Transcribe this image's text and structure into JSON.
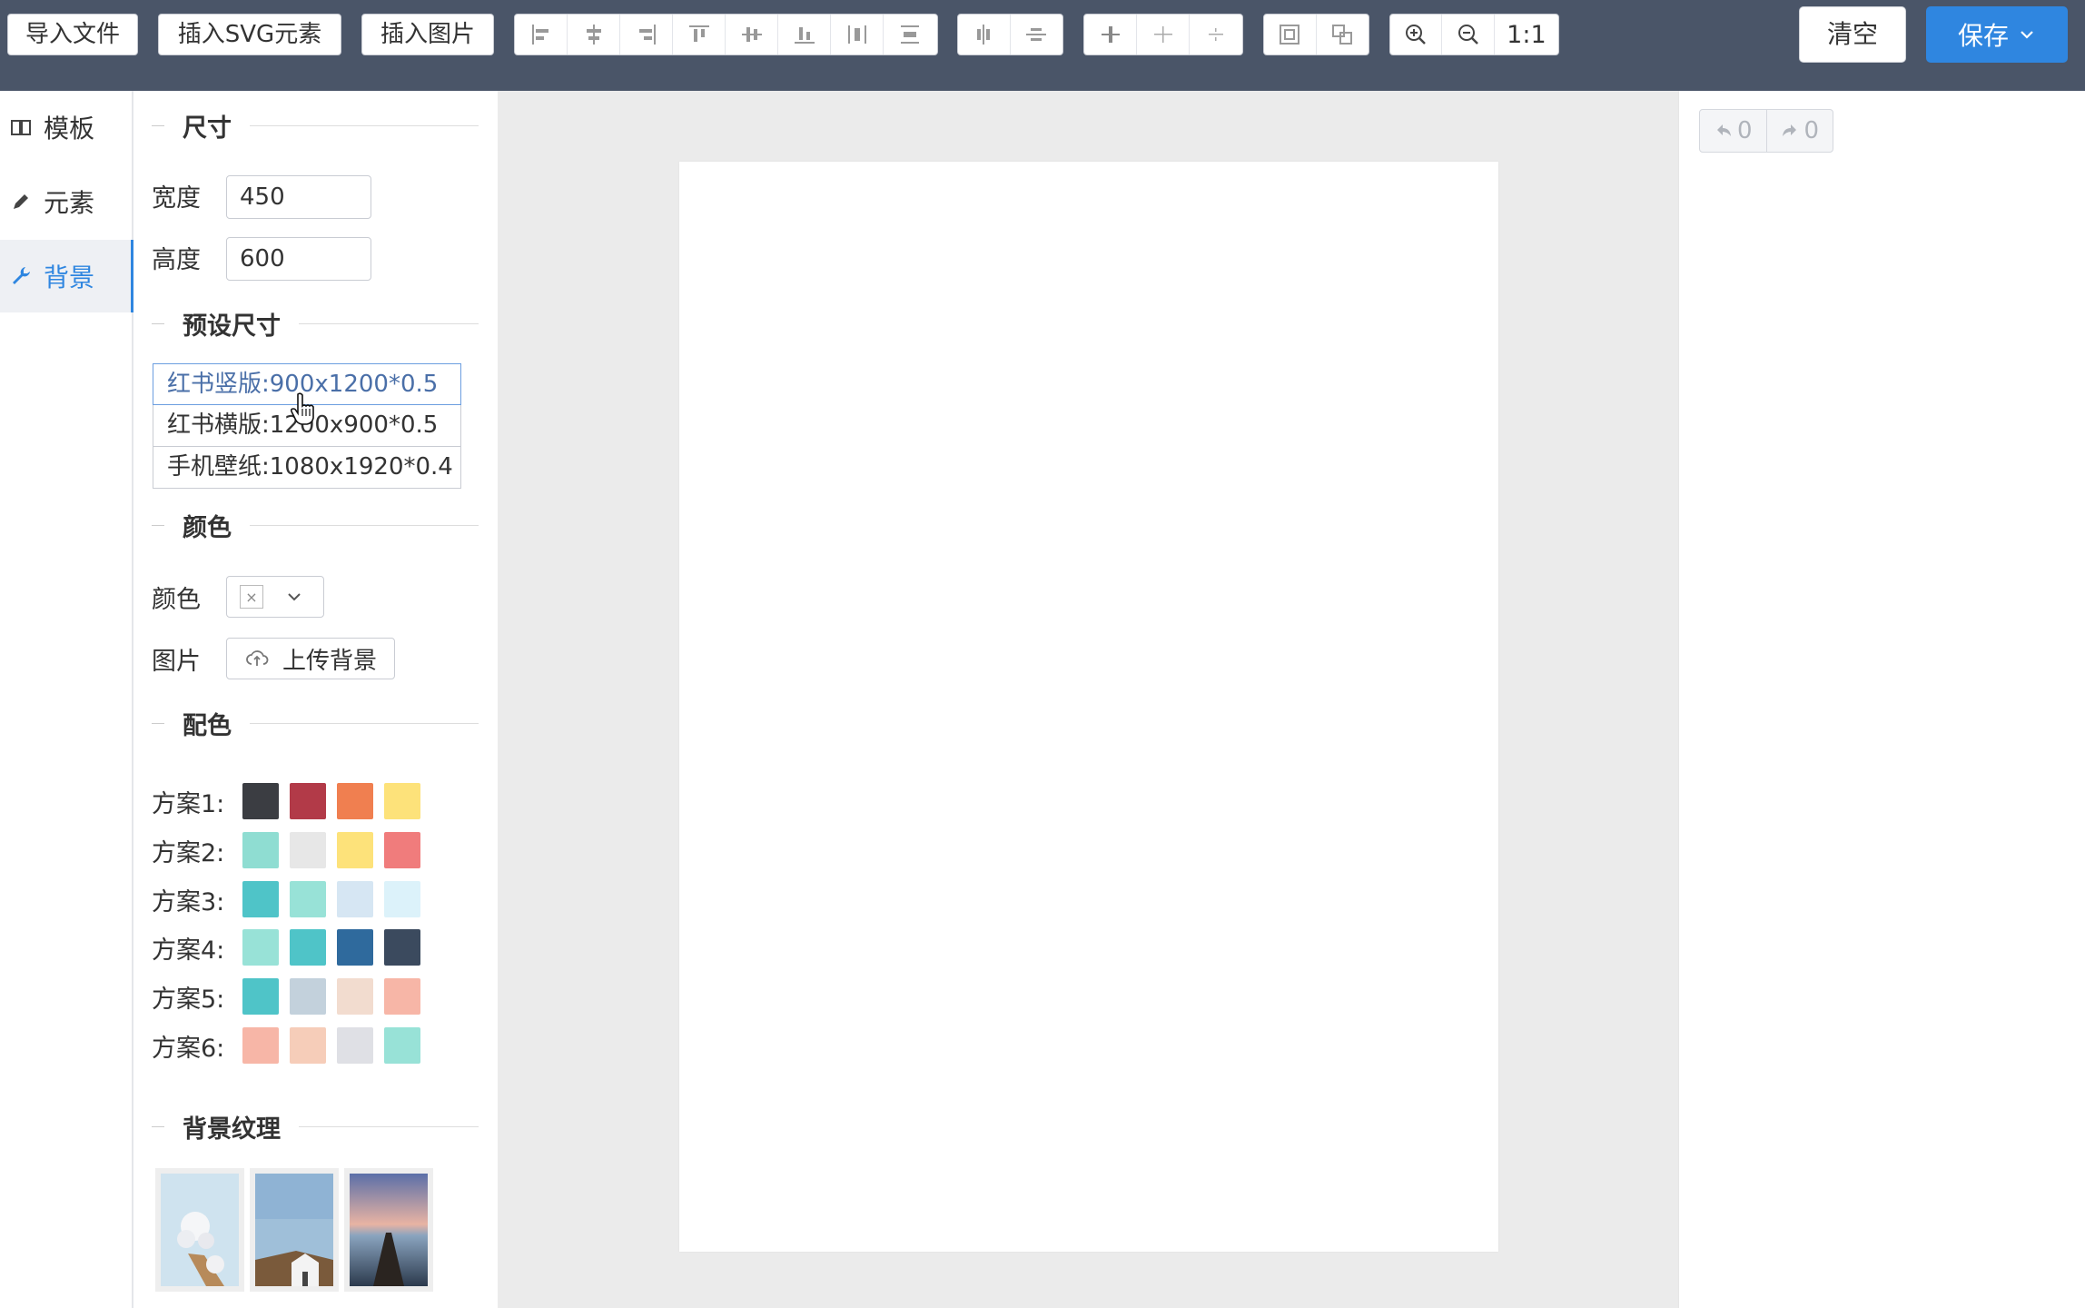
{
  "toolbar": {
    "import_file": "导入文件",
    "insert_svg": "插入SVG元素",
    "insert_image": "插入图片",
    "zoom_reset": "1:1",
    "clear": "清空",
    "save": "保存",
    "align_icons": [
      "align-left-icon",
      "align-center-h-icon",
      "align-right-icon",
      "align-top-icon",
      "align-middle-v-icon",
      "align-bottom-icon",
      "distribute-h-icon",
      "distribute-v-icon"
    ],
    "flip_icons": [
      "flip-horizontal-icon",
      "flip-vertical-icon"
    ],
    "layer_icons": [
      "layer-up-icon",
      "layer-center-icon",
      "layer-down-icon"
    ],
    "group_icons": [
      "group-icon",
      "ungroup-icon"
    ]
  },
  "nav": {
    "items": [
      {
        "label": "模板",
        "icon": "book-icon",
        "active": false
      },
      {
        "label": "元素",
        "icon": "pencil-icon",
        "active": false
      },
      {
        "label": "背景",
        "icon": "wrench-icon",
        "active": true
      }
    ]
  },
  "panel": {
    "size_title": "尺寸",
    "width_label": "宽度",
    "width_value": "450",
    "height_label": "高度",
    "height_value": "600",
    "preset_title": "预设尺寸",
    "presets": [
      "红书竖版:900x1200*0.5",
      "红书横版:1200x900*0.5",
      "手机壁纸:1080x1920*0.4"
    ],
    "color_title": "颜色",
    "color_label": "颜色",
    "color_swatch_mark": "×",
    "image_label": "图片",
    "upload_label": "上传背景",
    "palette_title": "配色",
    "schemes": [
      {
        "label": "方案1:",
        "colors": [
          "#3b3d42",
          "#b23a48",
          "#f07f50",
          "#fde27a"
        ]
      },
      {
        "label": "方案2:",
        "colors": [
          "#8fddd2",
          "#e7e7e7",
          "#fde27a",
          "#f07c7c"
        ]
      },
      {
        "label": "方案3:",
        "colors": [
          "#4fc4c8",
          "#98e2d7",
          "#d6e6f3",
          "#dcf2fa"
        ]
      },
      {
        "label": "方案4:",
        "colors": [
          "#98e2d7",
          "#4fc4c8",
          "#2f6a9d",
          "#3b4a5e"
        ]
      },
      {
        "label": "方案5:",
        "colors": [
          "#4fc4c8",
          "#c3d1dc",
          "#f2dccf",
          "#f7b6a7"
        ]
      },
      {
        "label": "方案6:",
        "colors": [
          "#f7b6a7",
          "#f6cdb9",
          "#dfe0e5",
          "#98e2d7"
        ]
      }
    ],
    "texture_title": "背景纹理"
  },
  "history": {
    "undo_count": "0",
    "redo_count": "0"
  },
  "colors": {
    "topbar": "#4a5568",
    "accent": "#2f86e0",
    "workspace": "#ebebeb"
  }
}
